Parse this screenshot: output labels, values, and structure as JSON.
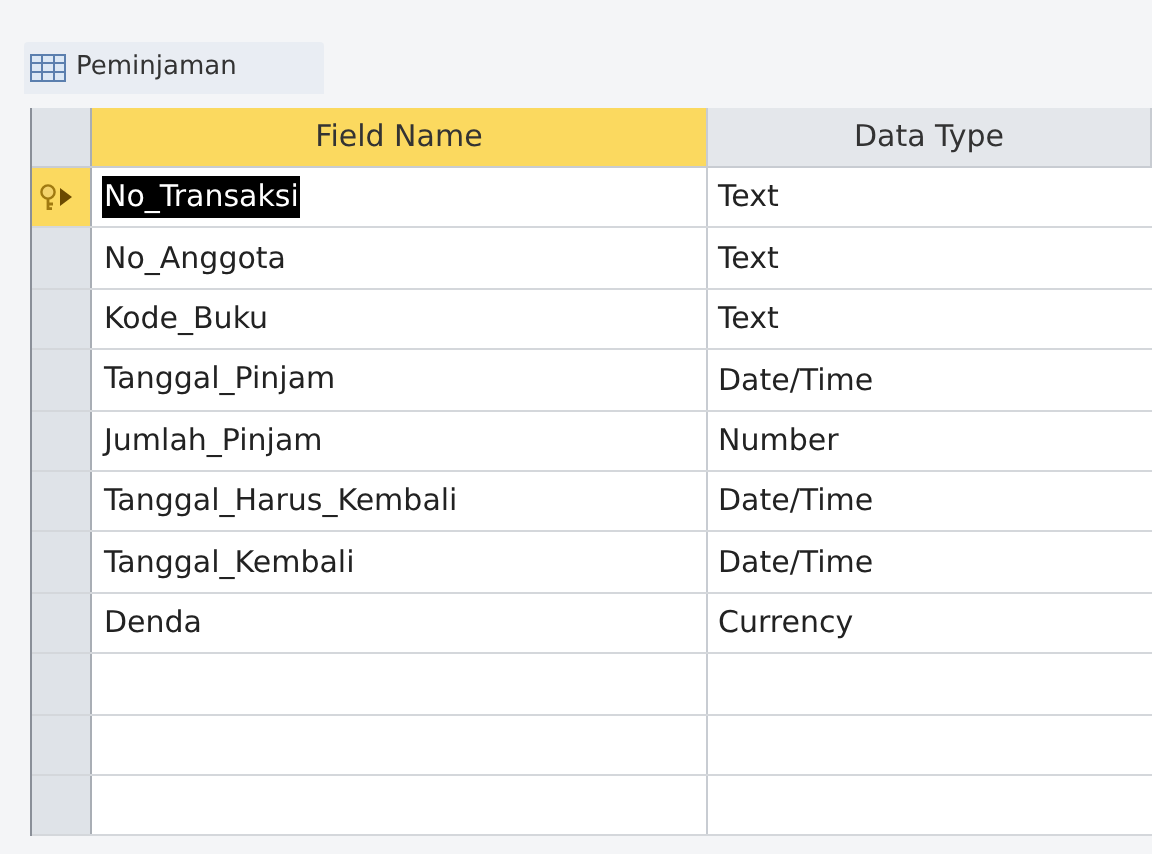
{
  "tab": {
    "title": "Peminjaman"
  },
  "columns": [
    {
      "label": "Field Name",
      "selected": true
    },
    {
      "label": "Data Type",
      "selected": false
    }
  ],
  "rows": [
    {
      "field_name": "No_Transaksi",
      "data_type": "Text",
      "primary_key": true,
      "selected": true
    },
    {
      "field_name": "No_Anggota",
      "data_type": "Text",
      "primary_key": false,
      "selected": false
    },
    {
      "field_name": "Kode_Buku",
      "data_type": "Text",
      "primary_key": false,
      "selected": false
    },
    {
      "field_name": "Tanggal_Pinjam",
      "data_type": "Date/Time",
      "primary_key": false,
      "selected": false
    },
    {
      "field_name": "Jumlah_Pinjam",
      "data_type": "Number",
      "primary_key": false,
      "selected": false
    },
    {
      "field_name": "Tanggal_Harus_Kembali",
      "data_type": "Date/Time",
      "primary_key": false,
      "selected": false
    },
    {
      "field_name": "Tanggal_Kembali",
      "data_type": "Date/Time",
      "primary_key": false,
      "selected": false
    },
    {
      "field_name": "Denda",
      "data_type": "Currency",
      "primary_key": false,
      "selected": false
    }
  ]
}
